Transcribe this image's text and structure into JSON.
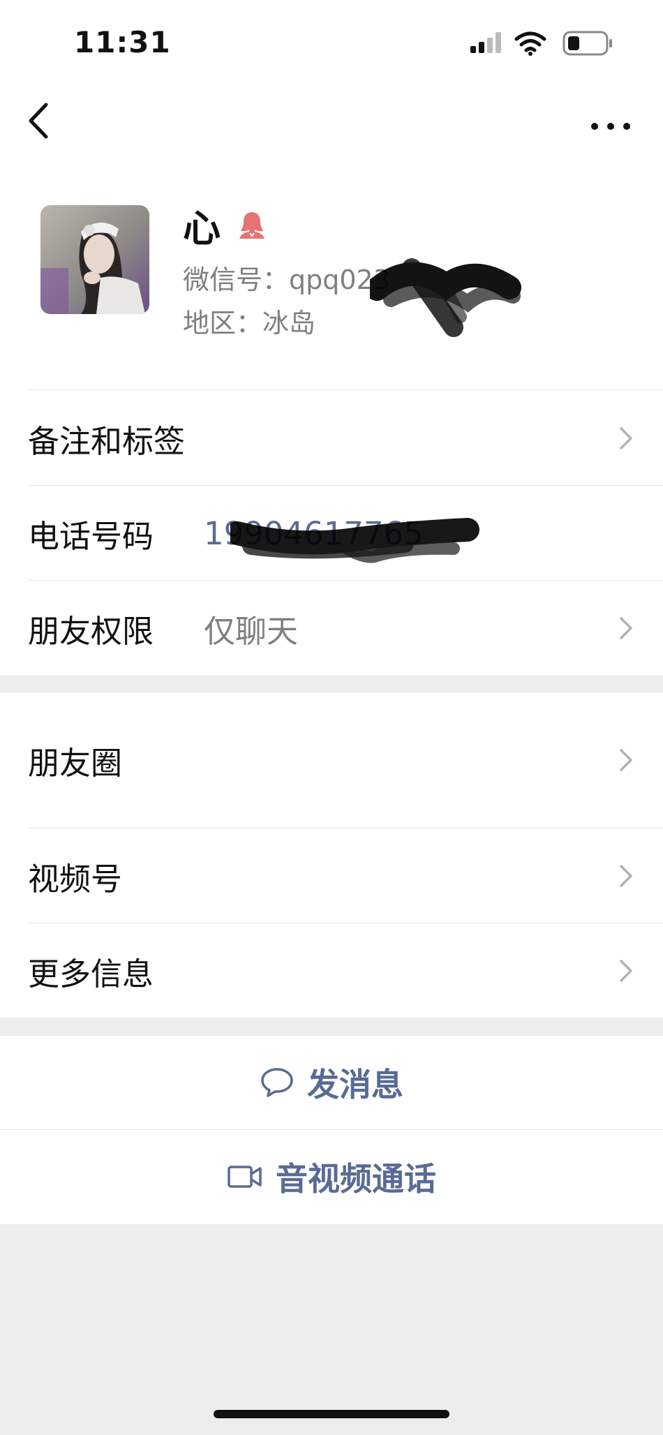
{
  "status_bar": {
    "time": "11:31"
  },
  "profile": {
    "name": "心",
    "wechat_id": "微信号：qpq023",
    "region": "地区：冰岛"
  },
  "rows": {
    "remarks_tags": {
      "label": "备注和标签"
    },
    "phone": {
      "label": "电话号码",
      "value": "19904617765"
    },
    "friend_permissions": {
      "label": "朋友权限",
      "value": "仅聊天"
    }
  },
  "rows2": {
    "moments": {
      "label": "朋友圈"
    },
    "channels": {
      "label": "视频号"
    },
    "more_info": {
      "label": "更多信息"
    }
  },
  "actions": {
    "send_message": "发消息",
    "video_call": "音视频通话"
  },
  "colors": {
    "accent": "#576b95",
    "secondary_text": "#7f7f7f",
    "background": "#ededed",
    "gender_female": "#e57373"
  },
  "icons": {
    "back": "chevron-left-icon",
    "more": "more-dots-icon",
    "gender": "female-icon",
    "chevron": "chevron-right-icon",
    "message": "chat-bubble-icon",
    "video": "video-camera-icon"
  }
}
